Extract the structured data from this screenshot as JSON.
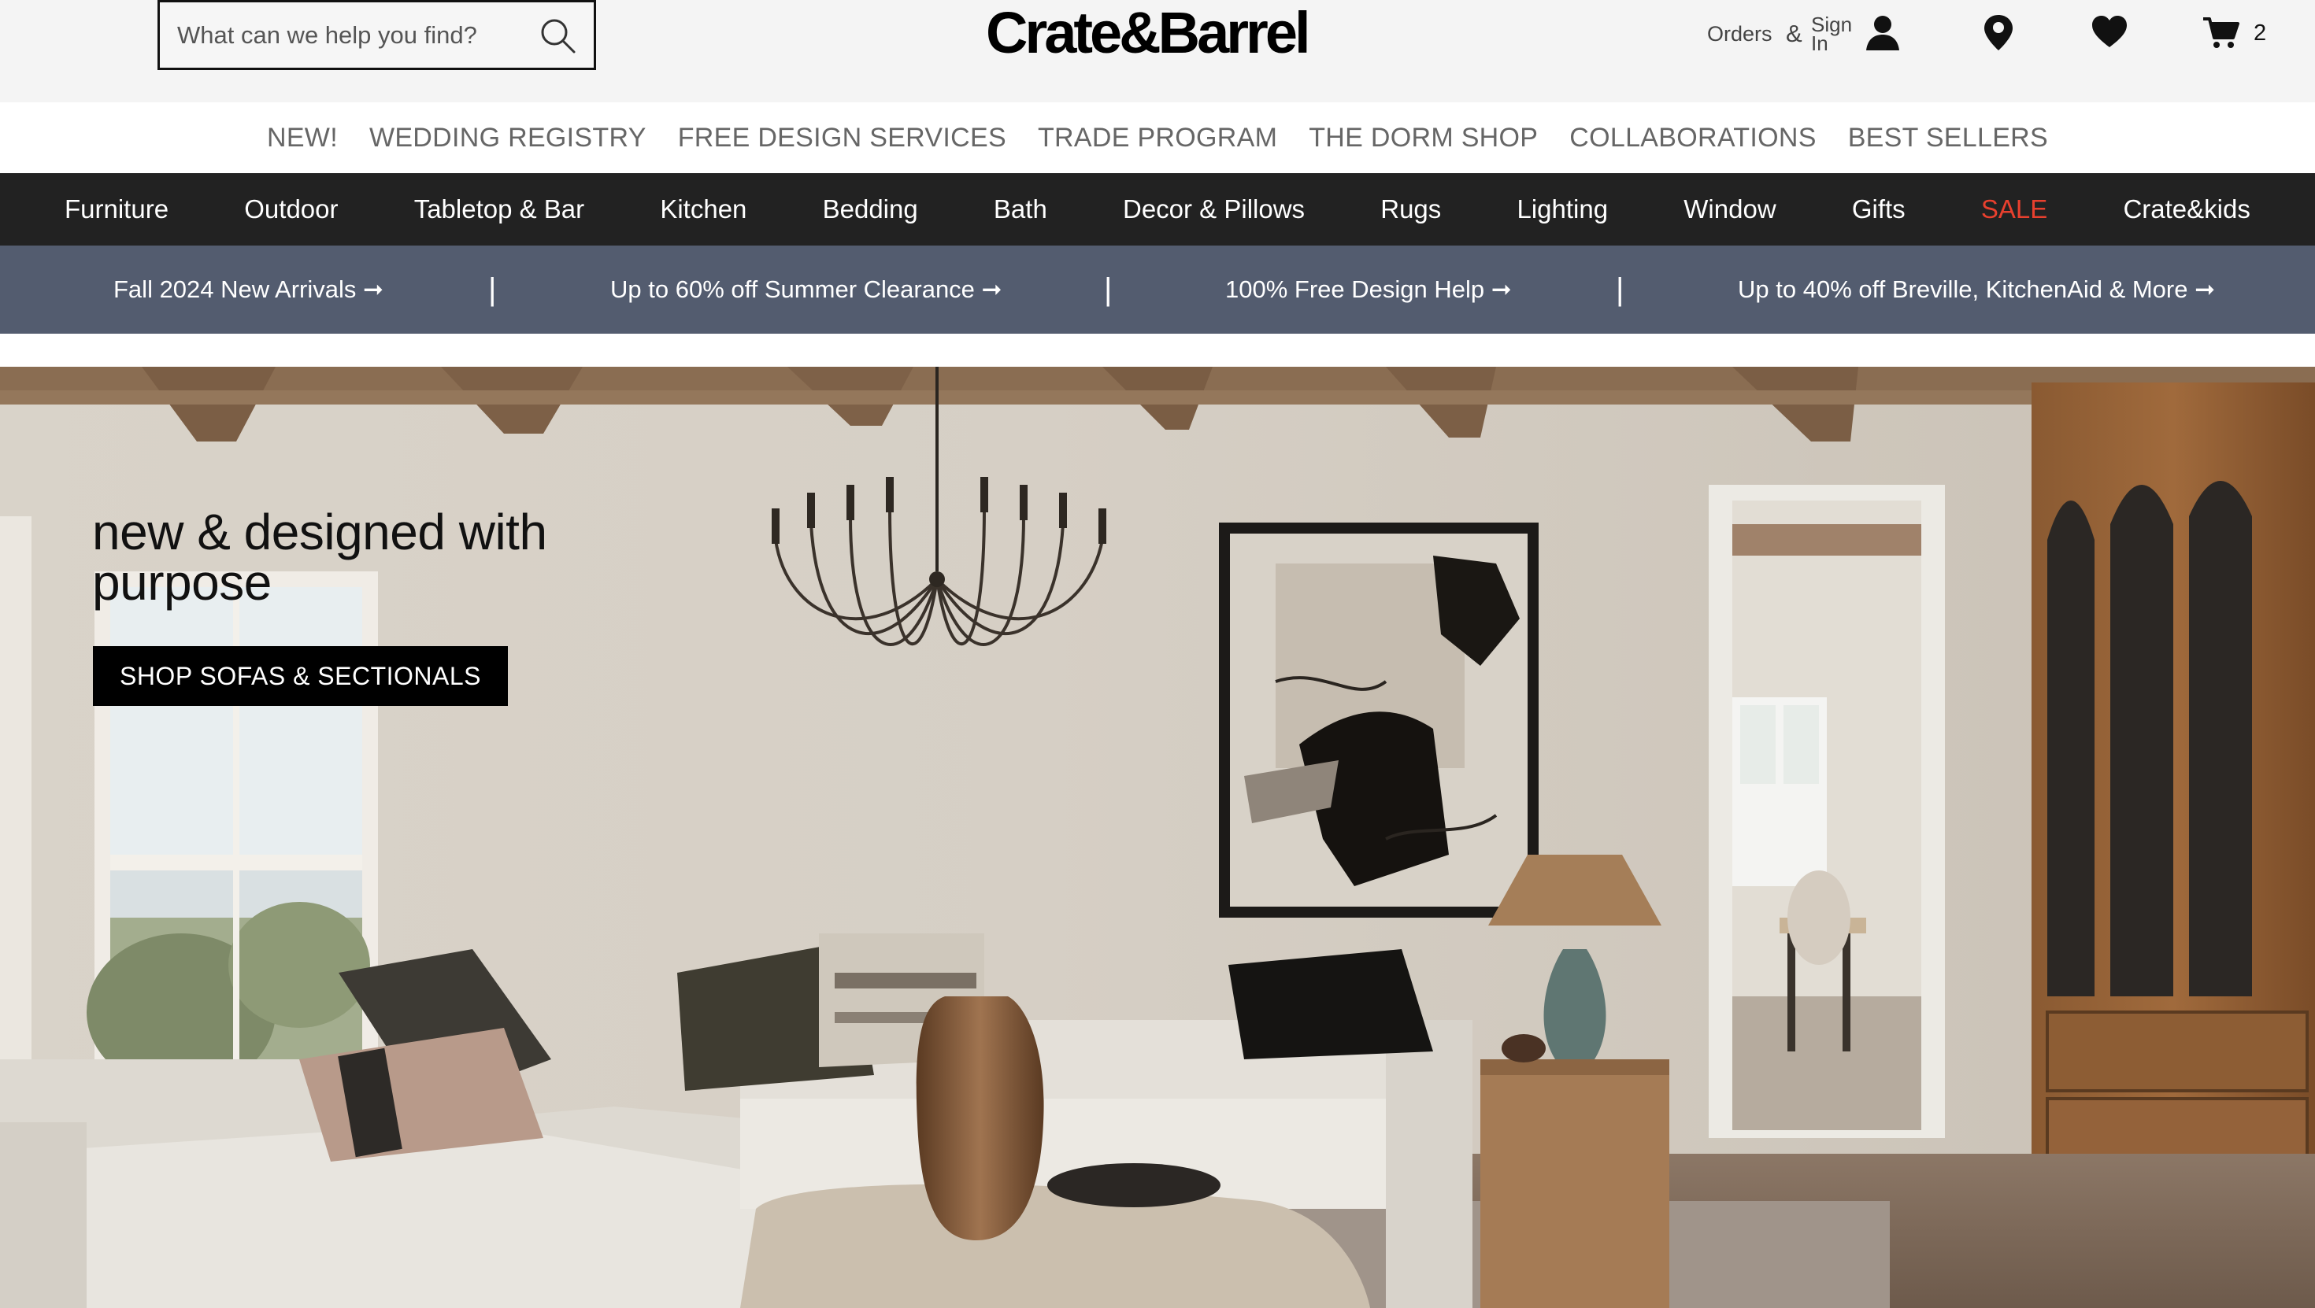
{
  "header": {
    "search_placeholder": "What can we help you find?",
    "logo_text": "Crate&Barrel",
    "orders_label": "Orders",
    "amp_label": "&",
    "signin_line1": "Sign",
    "signin_line2": "In",
    "cart_count": "2",
    "icons": [
      "search-icon",
      "account-icon",
      "location-pin-icon",
      "heart-icon",
      "cart-icon"
    ]
  },
  "subnav": {
    "items": [
      "NEW!",
      "WEDDING REGISTRY",
      "FREE DESIGN SERVICES",
      "TRADE PROGRAM",
      "THE DORM SHOP",
      "COLLABORATIONS",
      "BEST SELLERS"
    ]
  },
  "mainnav": {
    "items": [
      "Furniture",
      "Outdoor",
      "Tabletop & Bar",
      "Kitchen",
      "Bedding",
      "Bath",
      "Decor & Pillows",
      "Rugs",
      "Lighting",
      "Window",
      "Gifts",
      "SALE",
      "Crate&kids"
    ],
    "sale_color": "#e8402e"
  },
  "promobar": {
    "items": [
      "Fall 2024 New Arrivals ➞",
      "Up to 60% off Summer Clearance ➞",
      "100% Free Design Help ➞",
      "Up to 40% off Breville, KitchenAid & More ➞"
    ],
    "separator": "|"
  },
  "hero": {
    "title": "new & designed with purpose",
    "cta_label": "SHOP SOFAS & SECTIONALS"
  },
  "colors": {
    "header_bg": "#f4f4f4",
    "mainnav_bg": "#222222",
    "promobar_bg": "#535c6f",
    "cta_bg": "#000000"
  }
}
